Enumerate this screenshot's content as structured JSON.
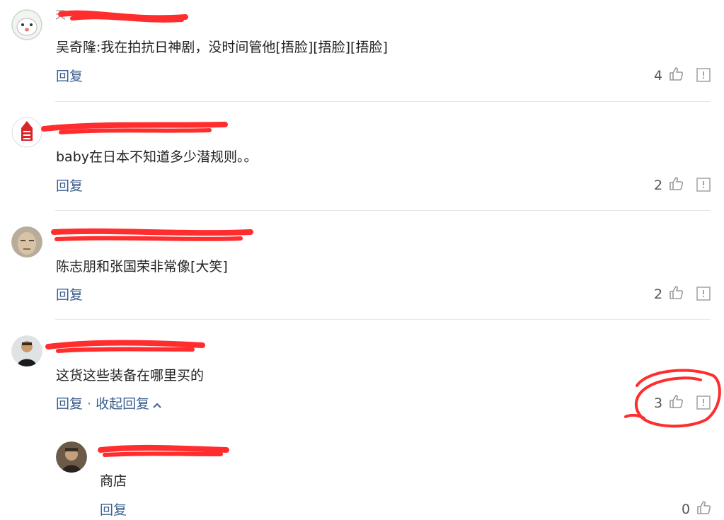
{
  "comments": [
    {
      "username_ghost": "天",
      "text": "吴奇隆:我在拍抗日神剧，没时间管他[捂脸][捂脸][捂脸]",
      "reply_label": "回复",
      "likes": "4"
    },
    {
      "username_ghost": "",
      "text": "baby在日本不知道多少潜规则。。",
      "reply_label": "回复",
      "likes": "2"
    },
    {
      "username_ghost": "",
      "text": "陈志朋和张国荣非常像[大笑]",
      "reply_label": "回复",
      "likes": "2"
    },
    {
      "username_ghost": "",
      "text": "这货这些装备在哪里买的",
      "reply_label": "回复",
      "collapse_label": "收起回复",
      "likes": "3"
    }
  ],
  "reply": {
    "username_ghost": "",
    "text": "商店",
    "reply_label": "回复",
    "likes": "0"
  },
  "colors": {
    "accent_link": "#3b5f8f",
    "redaction": "#ff2d2d",
    "divider": "#e6e6e6"
  },
  "icons": [
    "thumbs-up-icon",
    "report-icon",
    "chevron-up-icon"
  ]
}
